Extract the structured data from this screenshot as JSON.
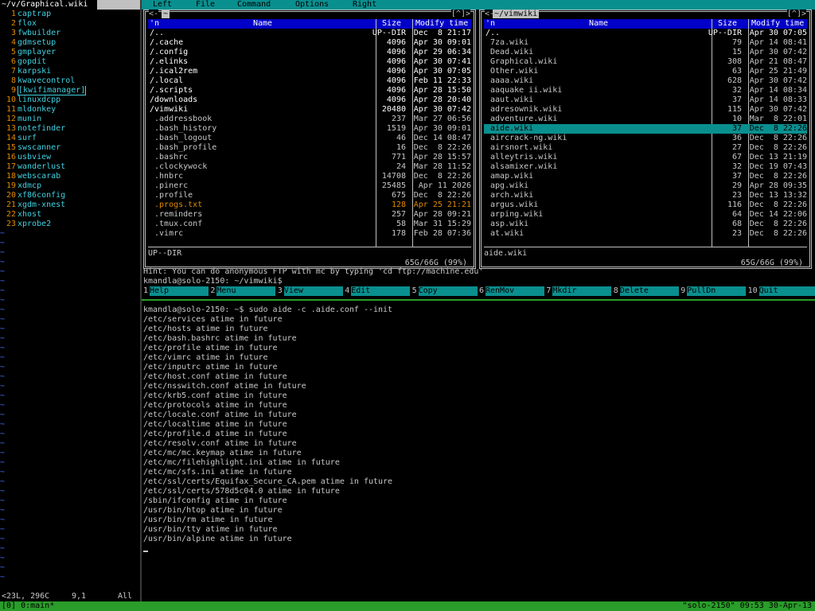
{
  "vim": {
    "title": "~/v/Graphical.wiki",
    "lines": [
      {
        "n": "1",
        "t": "captrap"
      },
      {
        "n": "2",
        "t": "flox"
      },
      {
        "n": "3",
        "t": "fwbuilder"
      },
      {
        "n": "4",
        "t": "gdmsetup"
      },
      {
        "n": "5",
        "t": "gmplayer"
      },
      {
        "n": "6",
        "t": "gopdit"
      },
      {
        "n": "7",
        "t": "karpski"
      },
      {
        "n": "8",
        "t": "kwavecontrol"
      },
      {
        "n": "9",
        "t": "[kwifimanager]"
      },
      {
        "n": "10",
        "t": "linuxdcpp"
      },
      {
        "n": "11",
        "t": "mldonkey"
      },
      {
        "n": "12",
        "t": "munin"
      },
      {
        "n": "13",
        "t": "notefinder"
      },
      {
        "n": "14",
        "t": "surf"
      },
      {
        "n": "15",
        "t": "swscanner"
      },
      {
        "n": "16",
        "t": "usbview"
      },
      {
        "n": "17",
        "t": "wanderlust"
      },
      {
        "n": "18",
        "t": "webscarab"
      },
      {
        "n": "19",
        "t": "xdmcp"
      },
      {
        "n": "20",
        "t": "xf86config"
      },
      {
        "n": "21",
        "t": "xgdm-xnest"
      },
      {
        "n": "22",
        "t": "xhost"
      },
      {
        "n": "23",
        "t": "xprobe2"
      }
    ],
    "tilde": "~",
    "status_left": "<23L, 296C",
    "status_pos": "9,1",
    "status_right": "All"
  },
  "mc": {
    "menu": [
      "Left",
      "File",
      "Command",
      "Options",
      "Right"
    ],
    "left_panel": {
      "title": "~",
      "corner": "[^]>",
      "corner_left": "<-",
      "headers": {
        "n": "'n",
        "name": "Name",
        "size": "Size",
        "time": "Modify time"
      },
      "files": [
        {
          "name": "/..",
          "size": "UP--DIR",
          "time": "Dec  8 21:17",
          "type": "dir"
        },
        {
          "name": "/.cache",
          "size": "4096",
          "time": "Apr 30 09:01",
          "type": "dir"
        },
        {
          "name": "/.config",
          "size": "4096",
          "time": "Apr 29 06:34",
          "type": "dir"
        },
        {
          "name": "/.elinks",
          "size": "4096",
          "time": "Apr 30 07:41",
          "type": "dir"
        },
        {
          "name": "/.ical2rem",
          "size": "4096",
          "time": "Apr 30 07:05",
          "type": "dir"
        },
        {
          "name": "/.local",
          "size": "4096",
          "time": "Feb 11 22:33",
          "type": "dir"
        },
        {
          "name": "/.scripts",
          "size": "4096",
          "time": "Apr 28 15:50",
          "type": "dir"
        },
        {
          "name": "/downloads",
          "size": "4096",
          "time": "Apr 28 20:40",
          "type": "dir"
        },
        {
          "name": "/vimwiki",
          "size": "20480",
          "time": "Apr 30 07:42",
          "type": "dir"
        },
        {
          "name": " .addressbook",
          "size": "237",
          "time": "Mar 27 06:56",
          "type": "file"
        },
        {
          "name": " .bash_history",
          "size": "1519",
          "time": "Apr 30 09:01",
          "type": "file"
        },
        {
          "name": " .bash_logout",
          "size": "46",
          "time": "Dec 14 08:47",
          "type": "file"
        },
        {
          "name": " .bash_profile",
          "size": "16",
          "time": "Dec  8 22:26",
          "type": "file"
        },
        {
          "name": " .bashrc",
          "size": "771",
          "time": "Apr 28 15:57",
          "type": "file"
        },
        {
          "name": " .clockywock",
          "size": "24",
          "time": "Mar 28 11:52",
          "type": "file"
        },
        {
          "name": " .hnbrc",
          "size": "14708",
          "time": "Dec  8 22:26",
          "type": "file"
        },
        {
          "name": " .pinerc",
          "size": "25485",
          "time": " Apr 11 2026",
          "type": "file"
        },
        {
          "name": " .profile",
          "size": "675",
          "time": "Dec  8 22:26",
          "type": "file"
        },
        {
          "name": " .progs.txt",
          "size": "128",
          "time": "Apr 25 21:21",
          "type": "orange"
        },
        {
          "name": " .reminders",
          "size": "257",
          "time": "Apr 28 09:21",
          "type": "file"
        },
        {
          "name": " .tmux.conf",
          "size": "58",
          "time": "Mar 31 15:29",
          "type": "file"
        },
        {
          "name": " .vimrc",
          "size": "178",
          "time": "Feb 28 07:36",
          "type": "file"
        }
      ],
      "info": "UP--DIR",
      "disk": "65G/66G (99%)"
    },
    "right_panel": {
      "title": "~/vimwiki",
      "corner": "[^]>",
      "corner_left": "<-",
      "headers": {
        "n": "'n",
        "name": "Name",
        "size": "Size",
        "time": "Modify time"
      },
      "files": [
        {
          "name": "/..",
          "size": "UP--DIR",
          "time": "Apr 30 07:05",
          "type": "dir"
        },
        {
          "name": " 7za.wiki",
          "size": "79",
          "time": "Apr 14 08:41",
          "type": "file"
        },
        {
          "name": " Dead.wiki",
          "size": "15",
          "time": "Apr 30 07:42",
          "type": "file"
        },
        {
          "name": " Graphical.wiki",
          "size": "308",
          "time": "Apr 21 08:47",
          "type": "file"
        },
        {
          "name": " Other.wiki",
          "size": "63",
          "time": "Apr 25 21:49",
          "type": "file"
        },
        {
          "name": " aaaa.wiki",
          "size": "628",
          "time": "Apr 30 07:42",
          "type": "file"
        },
        {
          "name": " aaquake ii.wiki",
          "size": "32",
          "time": "Apr 14 08:34",
          "type": "file"
        },
        {
          "name": " aaut.wiki",
          "size": "37",
          "time": "Apr 14 08:33",
          "type": "file"
        },
        {
          "name": " adresownik.wiki",
          "size": "115",
          "time": "Apr 30 07:42",
          "type": "file"
        },
        {
          "name": " adventure.wiki",
          "size": "10",
          "time": "Mar  8 22:01",
          "type": "file"
        },
        {
          "name": " aide.wiki",
          "size": "37",
          "time": "Dec  8 22:26",
          "type": "sel"
        },
        {
          "name": " aircrack-ng.wiki",
          "size": "36",
          "time": "Dec  8 22:26",
          "type": "file"
        },
        {
          "name": " airsnort.wiki",
          "size": "27",
          "time": "Dec  8 22:26",
          "type": "file"
        },
        {
          "name": " alleytris.wiki",
          "size": "67",
          "time": "Dec 13 21:19",
          "type": "file"
        },
        {
          "name": " alsamixer.wiki",
          "size": "32",
          "time": "Dec 19 07:43",
          "type": "file"
        },
        {
          "name": " amap.wiki",
          "size": "37",
          "time": "Dec  8 22:26",
          "type": "file"
        },
        {
          "name": " apg.wiki",
          "size": "29",
          "time": "Apr 28 09:35",
          "type": "file"
        },
        {
          "name": " arch.wiki",
          "size": "23",
          "time": "Dec 13 13:32",
          "type": "file"
        },
        {
          "name": " argus.wiki",
          "size": "116",
          "time": "Dec  8 22:26",
          "type": "file"
        },
        {
          "name": " arping.wiki",
          "size": "64",
          "time": "Dec 14 22:06",
          "type": "file"
        },
        {
          "name": " asp.wiki",
          "size": "68",
          "time": "Dec  8 22:26",
          "type": "file"
        },
        {
          "name": " at.wiki",
          "size": "23",
          "time": "Dec  8 22:26",
          "type": "file"
        }
      ],
      "info": "aide.wiki",
      "disk": "65G/66G (99%)"
    },
    "hint": "Hint: You can do anonymous FTP with mc by typing 'cd ftp://machine.edu'",
    "prompt": "kmandla@solo-2150: ~/vimwiki$",
    "fkeys": [
      {
        "num": "1",
        "label": "Help"
      },
      {
        "num": "2",
        "label": "Menu"
      },
      {
        "num": "3",
        "label": "View"
      },
      {
        "num": "4",
        "label": "Edit"
      },
      {
        "num": "5",
        "label": "Copy"
      },
      {
        "num": "6",
        "label": "RenMov"
      },
      {
        "num": "7",
        "label": "Mkdir"
      },
      {
        "num": "8",
        "label": "Delete"
      },
      {
        "num": "9",
        "label": "PullDn"
      },
      {
        "num": "10",
        "label": "Quit"
      }
    ]
  },
  "terminal": {
    "lines": [
      "kmandla@solo-2150: ~$ sudo aide -c .aide.conf --init",
      "/etc/services atime in future",
      "/etc/hosts atime in future",
      "/etc/bash.bashrc atime in future",
      "/etc/profile atime in future",
      "/etc/vimrc atime in future",
      "/etc/inputrc atime in future",
      "/etc/host.conf atime in future",
      "/etc/nsswitch.conf atime in future",
      "/etc/krb5.conf atime in future",
      "/etc/protocols atime in future",
      "/etc/locale.conf atime in future",
      "/etc/localtime atime in future",
      "/etc/profile.d atime in future",
      "/etc/resolv.conf atime in future",
      "/etc/mc/mc.keymap atime in future",
      "/etc/mc/filehighlight.ini atime in future",
      "/etc/mc/sfs.ini atime in future",
      "/etc/ssl/certs/Equifax_Secure_CA.pem atime in future",
      "/etc/ssl/certs/578d5c04.0 atime in future",
      "/sbin/ifconfig atime in future",
      "/usr/bin/htop atime in future",
      "/usr/bin/rm atime in future",
      "/usr/bin/tty atime in future",
      "/usr/bin/alpine atime in future"
    ]
  },
  "tmux": {
    "left": "[0] 0:main*",
    "right": "\"solo-2150\" 09:53 30-Apr-13"
  },
  "colors": {
    "cyan": "#0a8f8f",
    "blue": "#0000c8",
    "green": "#2a9d2a",
    "orange": "#e08a00"
  }
}
